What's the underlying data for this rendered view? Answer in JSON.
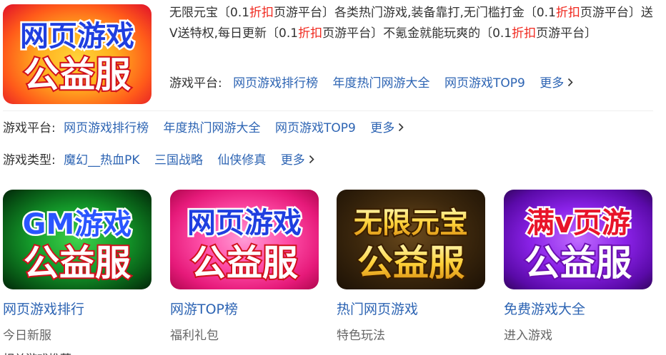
{
  "hero": {
    "logo": {
      "line1": "网页游戏",
      "line2": "公益服"
    },
    "description": [
      {
        "t": "无限元宝〔0.1",
        "red": false
      },
      {
        "t": "折扣",
        "red": true
      },
      {
        "t": "页游平台〕各类热门游戏,装备靠打,无门槛打金〔0.1",
        "red": false
      },
      {
        "t": "折扣",
        "red": true
      },
      {
        "t": "页游平台〕送V送特权,每日更新〔0.1",
        "red": false
      },
      {
        "t": "折扣",
        "red": true
      },
      {
        "t": "页游平台〕不氪金就能玩爽的〔0.1",
        "red": false
      },
      {
        "t": "折扣",
        "red": true
      },
      {
        "t": "页游平台〕",
        "red": false
      }
    ],
    "platform_label": "游戏平台:",
    "platform_links": [
      "网页游戏排行榜",
      "年度热门网游大全",
      "网页游戏TOP9"
    ],
    "more": "更多"
  },
  "platform_row": {
    "label": "游戏平台:",
    "links": [
      "网页游戏排行榜",
      "年度热门网游大全",
      "网页游戏TOP9"
    ],
    "more": "更多"
  },
  "type_row": {
    "label": "游戏类型:",
    "links": [
      "魔幻__热血PK",
      "三国战略",
      "仙侠修真"
    ],
    "more": "更多"
  },
  "cards": [
    {
      "title": "网页游戏排行",
      "sub": "今日新服",
      "logo1": "GM游戏",
      "logo2": "公益服"
    },
    {
      "title": "网游TOP榜",
      "sub": "福利礼包",
      "logo1": "网页游戏",
      "logo2": "公益服"
    },
    {
      "title": "热门网页游戏",
      "sub": "特色玩法",
      "logo1": "无限元宝",
      "logo2": "公益服"
    },
    {
      "title": "免费游戏大全",
      "sub": "进入游戏",
      "logo1": "满v页游",
      "logo2": "公益服"
    }
  ],
  "cutoff_text": "相关游戏推荐"
}
